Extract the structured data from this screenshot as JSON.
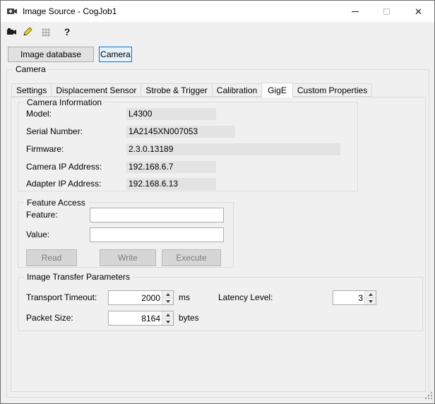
{
  "window": {
    "title": "Image Source - CogJob1"
  },
  "titlebar_controls": {
    "close_glyph": "✕"
  },
  "toolbar": {
    "icons": [
      "camera-icon",
      "edit-pencil-icon",
      "calibration-grid-icon",
      "help-icon"
    ],
    "help_glyph": "?"
  },
  "source_buttons": {
    "image_database": "Image database",
    "camera": "Camera"
  },
  "camera_group": {
    "label": "Camera"
  },
  "tabs": [
    {
      "label": "Settings",
      "active": false
    },
    {
      "label": "Displacement Sensor",
      "active": false
    },
    {
      "label": "Strobe & Trigger",
      "active": false
    },
    {
      "label": "Calibration",
      "active": false
    },
    {
      "label": "GigE",
      "active": true
    },
    {
      "label": "Custom Properties",
      "active": false
    }
  ],
  "camera_information": {
    "label": "Camera Information",
    "fields": [
      {
        "label": "Model:",
        "value": "L4300"
      },
      {
        "label": "Serial Number:",
        "value": "1A2145XN007053"
      },
      {
        "label": "Firmware:",
        "value": "2.3.0.13189"
      },
      {
        "label": "Camera IP Address:",
        "value": "192.168.6.7"
      },
      {
        "label": "Adapter IP Address:",
        "value": "192.168.6.13"
      }
    ]
  },
  "feature_access": {
    "label": "Feature Access",
    "feature_label": "Feature:",
    "feature_value": "",
    "value_label": "Value:",
    "value_value": "",
    "buttons": {
      "read": "Read",
      "write": "Write",
      "execute": "Execute"
    }
  },
  "image_transfer": {
    "label": "Image Transfer Parameters",
    "transport_timeout": {
      "label": "Transport Timeout:",
      "value": "2000",
      "unit": "ms"
    },
    "latency_level": {
      "label": "Latency Level:",
      "value": "3"
    },
    "packet_size": {
      "label": "Packet Size:",
      "value": "8164",
      "unit": "bytes"
    }
  },
  "colors": {
    "selected_button_border": "#0078d7",
    "selected_button_bg": "#e5f1fb",
    "info_value_bg": "#e3e3e3",
    "window_bg": "#f0f0f0",
    "titlebar_bg": "#ffffff"
  }
}
